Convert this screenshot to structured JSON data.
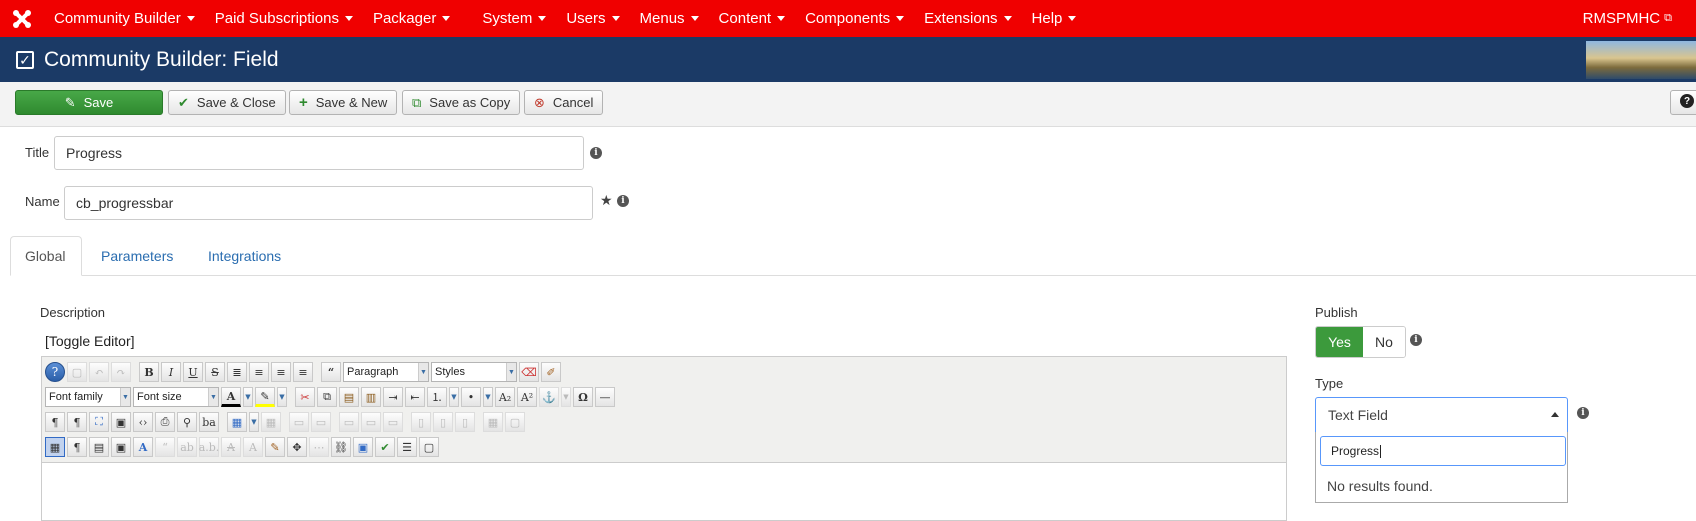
{
  "topnav": {
    "items": [
      "Community Builder",
      "Paid Subscriptions",
      "Packager",
      "System",
      "Users",
      "Menus",
      "Content",
      "Components",
      "Extensions",
      "Help"
    ],
    "user": "RMSPMHC",
    "bg_color": "#f00000"
  },
  "header": {
    "title": "Community Builder: Field",
    "bg_color": "#1b3a66"
  },
  "toolbar": {
    "save": "Save",
    "save_close": "Save & Close",
    "save_new": "Save & New",
    "save_copy": "Save as Copy",
    "cancel": "Cancel"
  },
  "form": {
    "title_label": "Title",
    "title_value": "Progress",
    "name_label": "Name",
    "name_value": "cb_progressbar"
  },
  "tabs": [
    "Global",
    "Parameters",
    "Integrations"
  ],
  "description": {
    "label": "Description",
    "toggle": "[Toggle Editor]",
    "paragraph_select": "Paragraph",
    "styles_select": "Styles",
    "font_family_select": "Font family",
    "font_size_select": "Font size"
  },
  "publish": {
    "label": "Publish",
    "yes": "Yes",
    "no": "No",
    "selected": "Yes"
  },
  "type": {
    "label": "Type",
    "selected": "Text Field",
    "search_value": "Progress",
    "no_results": "No results found."
  }
}
